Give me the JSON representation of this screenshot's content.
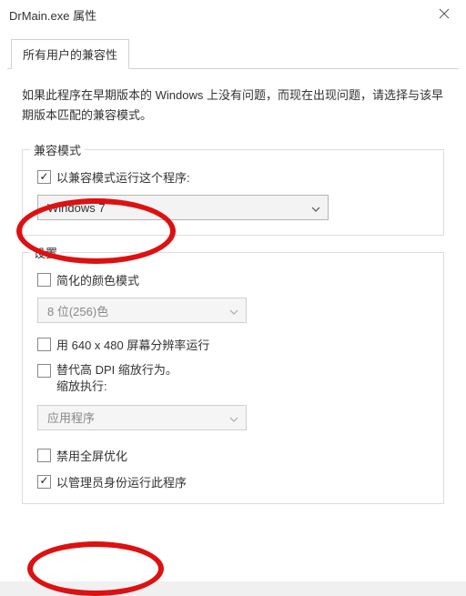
{
  "titlebar": {
    "title": "DrMain.exe 属性"
  },
  "tab": {
    "label": "所有用户的兼容性"
  },
  "intro": "如果此程序在早期版本的 Windows 上没有问题，而现在出现问题，请选择与该早期版本匹配的兼容模式。",
  "compat": {
    "group_title": "兼容模式",
    "run_in_compat_label": "以兼容模式运行这个程序:",
    "selected_os": "Windows 7"
  },
  "settings": {
    "group_title": "设置",
    "reduced_color_label": "简化的颜色模式",
    "color_select": "8 位(256)色",
    "run_640_label": "用 640 x 480 屏幕分辨率运行",
    "dpi_override_label_line1": "替代高 DPI 缩放行为。",
    "dpi_override_label_line2": "缩放执行:",
    "dpi_select": "应用程序",
    "disable_fullscreen_label": "禁用全屏优化",
    "run_as_admin_label": "以管理员身份运行此程序"
  }
}
